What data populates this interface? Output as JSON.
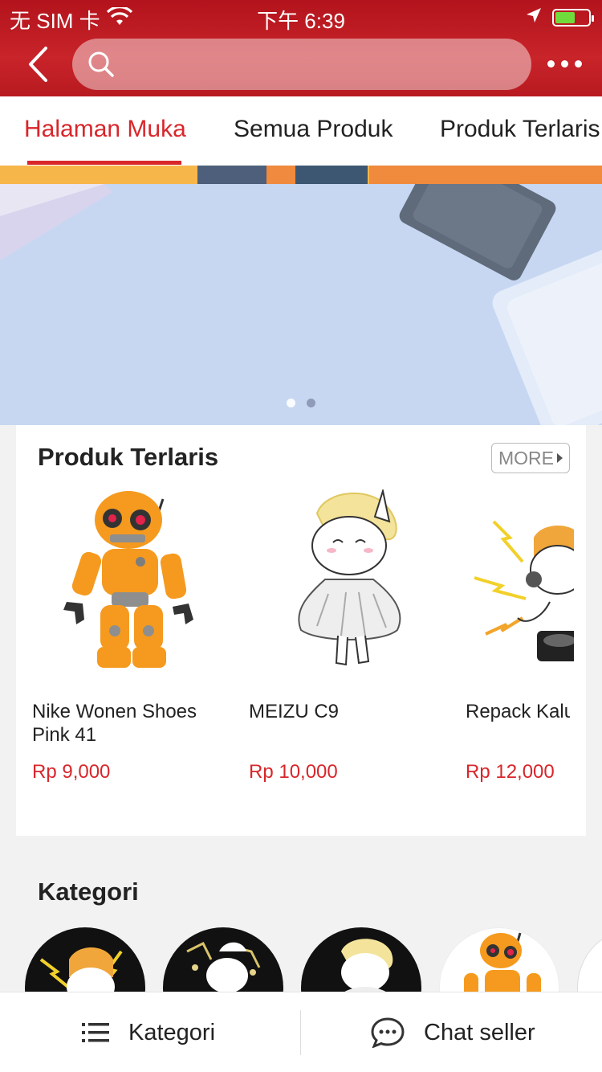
{
  "status_bar": {
    "carrier": "无 SIM 卡",
    "time": "下午 6:39"
  },
  "navbar": {
    "search_placeholder": "",
    "icons": [
      "chevron-left-icon",
      "search-icon",
      "more-dots-icon"
    ]
  },
  "tabs": [
    {
      "label": "Halaman Muka",
      "active": true
    },
    {
      "label": "Semua Produk",
      "active": false
    },
    {
      "label": "Produk Terlaris",
      "active": false
    }
  ],
  "banner": {
    "pages": 2,
    "current_page": 1
  },
  "best_sellers": {
    "title": "Produk Terlaris",
    "more_label": "MORE",
    "products": [
      {
        "name": "Nike Wonen Shoes Pink 41",
        "price": "Rp 9,000",
        "image": "orange-robot"
      },
      {
        "name": "MEIZU C9",
        "price": "Rp 10,000",
        "image": "white-unicorn"
      },
      {
        "name": "Repack Kalu",
        "price": "Rp 12,000",
        "image": "unicorn-dj"
      }
    ]
  },
  "categories": {
    "title": "Kategori"
  },
  "bottom_bar": {
    "category_label": "Kategori",
    "chat_label": "Chat seller"
  },
  "colors": {
    "brand_red": "#c8242a",
    "accent_red": "#d8262b",
    "text": "#222222"
  }
}
